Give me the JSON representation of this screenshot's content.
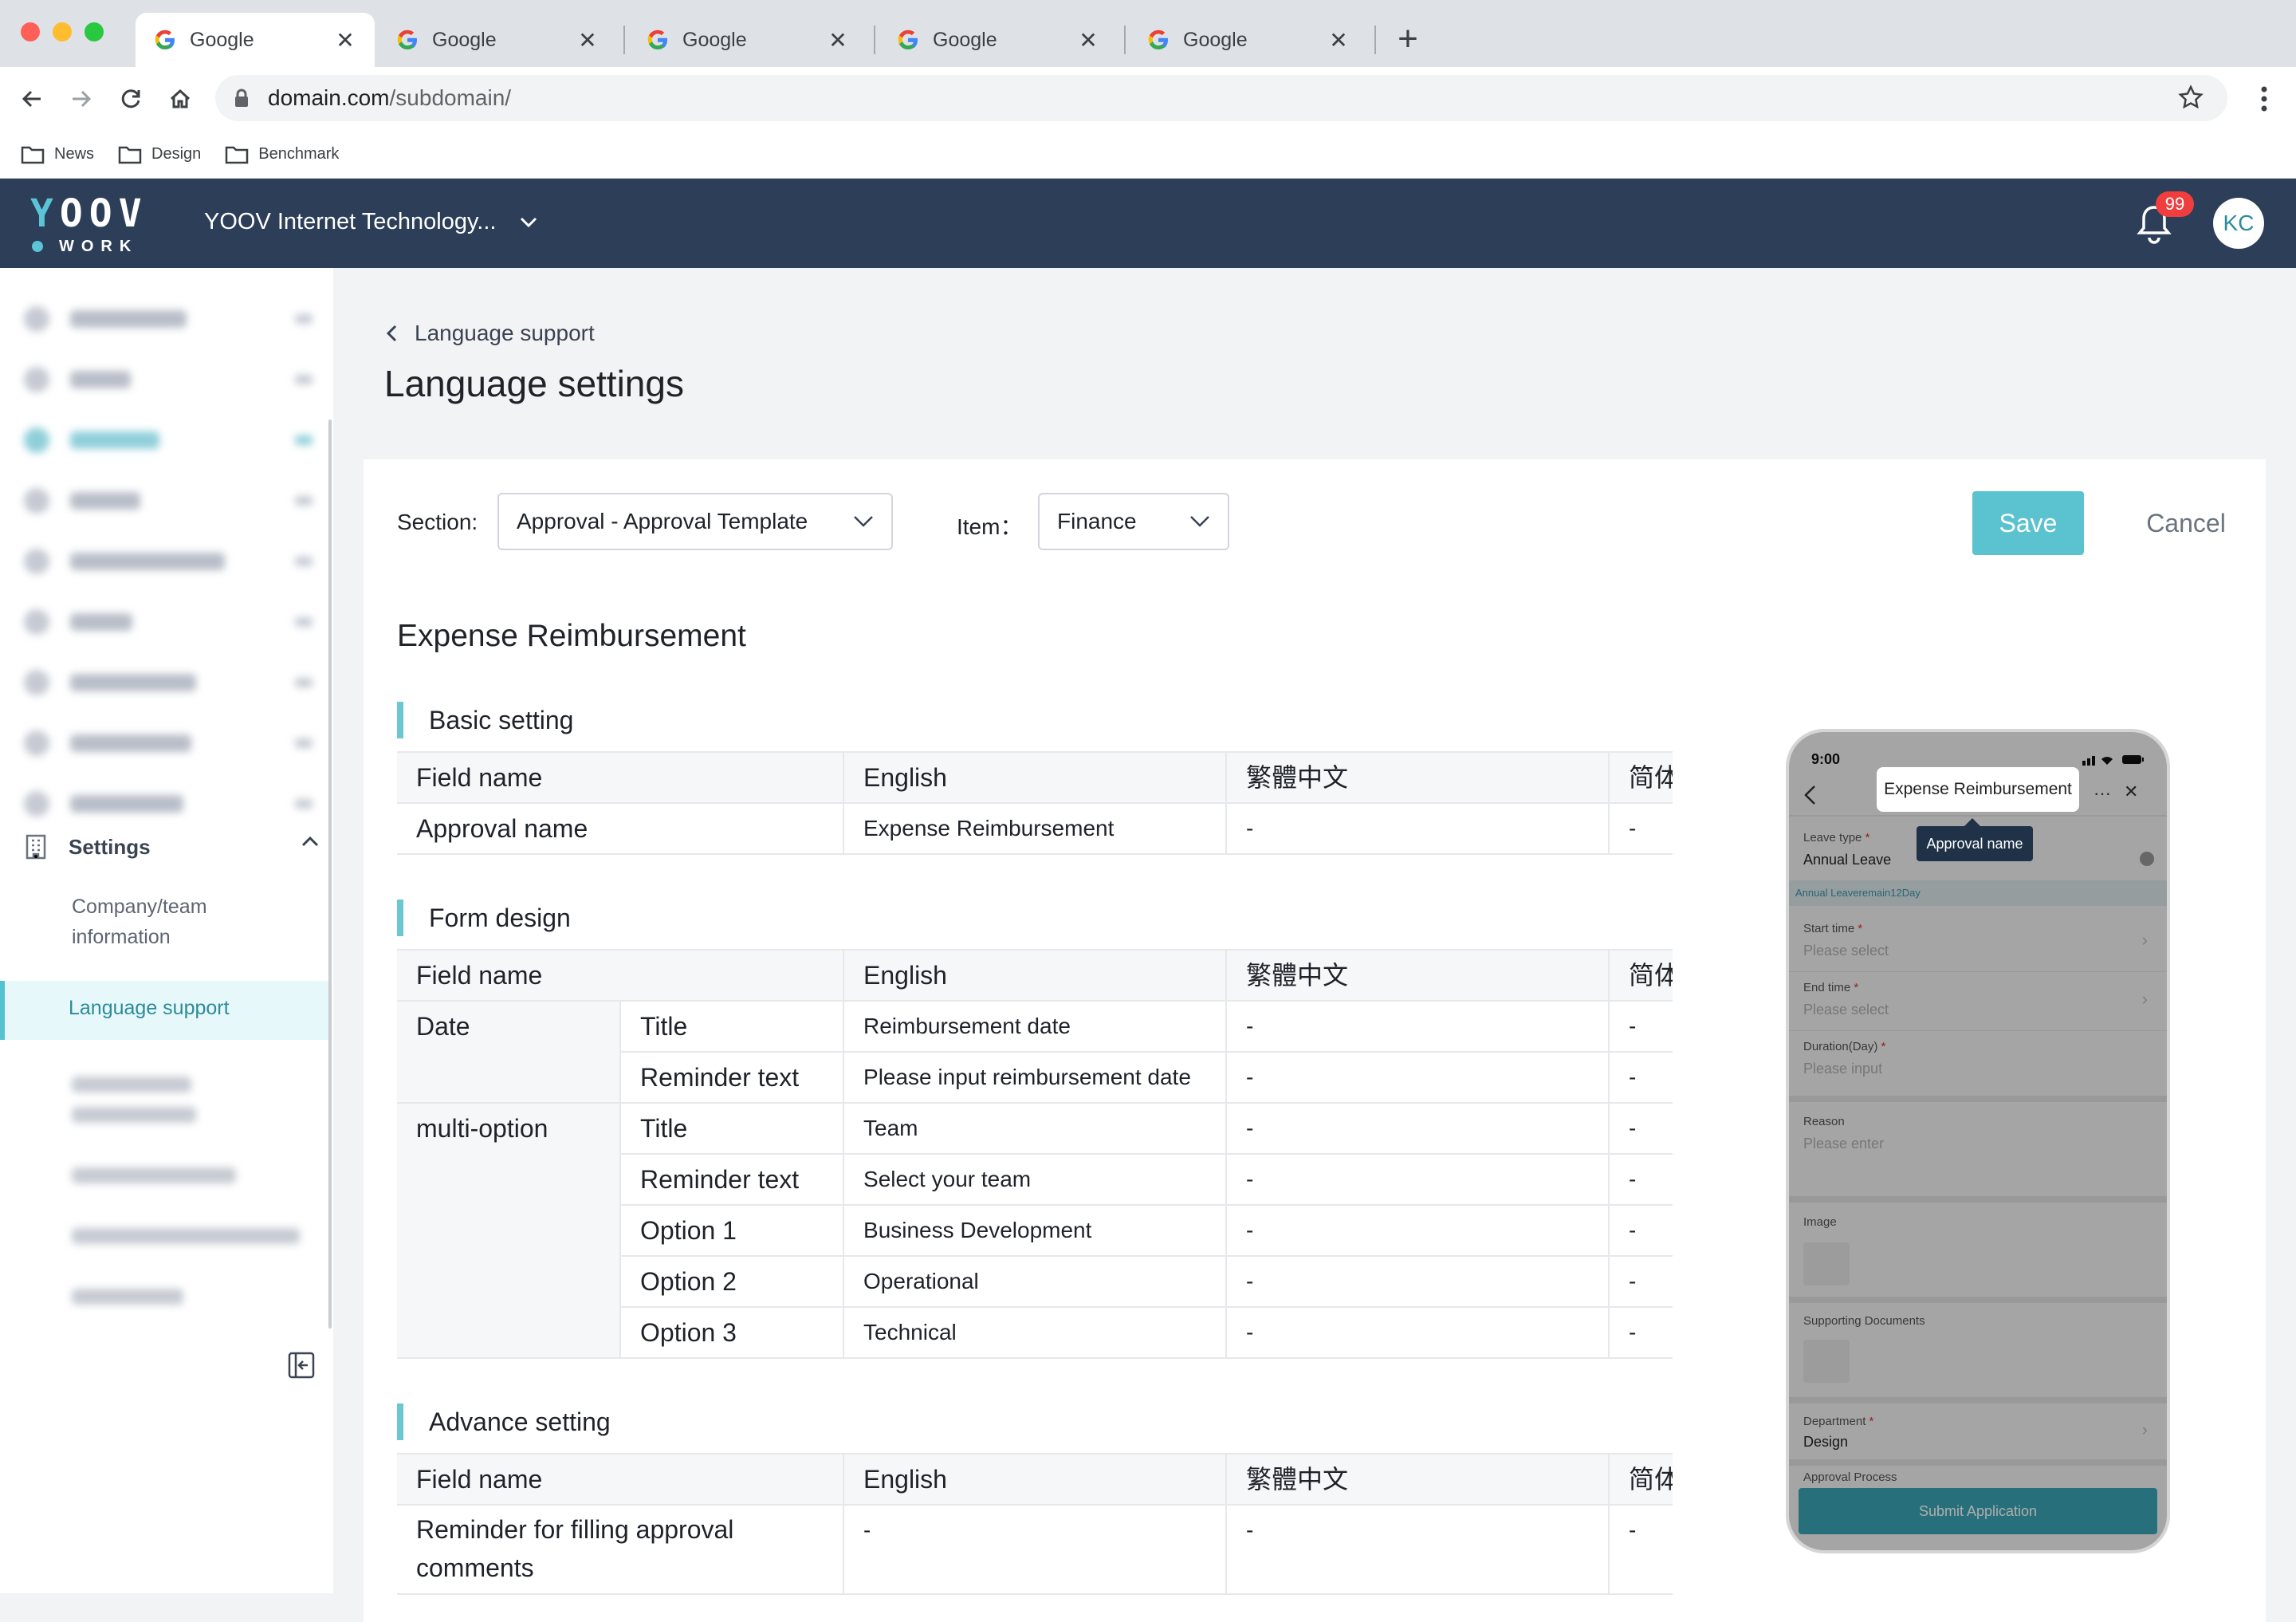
{
  "browser": {
    "tabs": [
      {
        "title": "Google",
        "active": true
      },
      {
        "title": "Google",
        "active": false
      },
      {
        "title": "Google",
        "active": false
      },
      {
        "title": "Google",
        "active": false
      },
      {
        "title": "Google",
        "active": false
      }
    ],
    "tab_close": "✕",
    "new_tab": "+",
    "url_domain": "domain.com",
    "url_path": "/subdomain/",
    "bookmarks": [
      "News",
      "Design",
      "Benchmark"
    ]
  },
  "header": {
    "logo_main": "YOOV",
    "logo_y": "Y",
    "logo_rest": "OOV",
    "logo_sub": "WORK",
    "company": "YOOV Internet Technology...",
    "notification_count": "99",
    "avatar_initials": "KC",
    "accent_color": "#2c3e58",
    "badge_color": "#f03e3e"
  },
  "sidebar": {
    "settings_label": "Settings",
    "company_info": "Company/team information",
    "company_info_line1": "Company/team",
    "company_info_line2": "information",
    "language_support": "Language support"
  },
  "main": {
    "breadcrumb": "Language support",
    "title": "Language settings",
    "section_label": "Section:",
    "section_value": "Approval - Approval Template",
    "item_label": "Item：",
    "item_value": "Finance",
    "save_label": "Save",
    "cancel_label": "Cancel",
    "heading": "Expense Reimbursement",
    "basic": {
      "title": "Basic setting",
      "headers": [
        "Field name",
        "English",
        "繁體中文",
        "简体"
      ],
      "row": {
        "field": "Approval name",
        "english": "Expense Reimbursement",
        "trad": "-",
        "simp": "-"
      }
    },
    "form": {
      "title": "Form design",
      "headers": [
        "Field name",
        "English",
        "繁體中文",
        "简体"
      ],
      "groups": [
        {
          "name": "Date",
          "rows": [
            {
              "field": "Title",
              "english": "Reimbursement date",
              "trad": "-",
              "simp": "-"
            },
            {
              "field": "Reminder text",
              "english": "Please input reimbursement date",
              "trad": "-",
              "simp": "-"
            }
          ]
        },
        {
          "name": "multi-option",
          "rows": [
            {
              "field": "Title",
              "english": "Team",
              "trad": "-",
              "simp": "-"
            },
            {
              "field": "Reminder text",
              "english": "Select your team",
              "trad": "-",
              "simp": "-"
            },
            {
              "field": "Option 1",
              "english": "Business Development",
              "trad": "-",
              "simp": "-"
            },
            {
              "field": "Option 2",
              "english": "Operational",
              "trad": "-",
              "simp": "-"
            },
            {
              "field": "Option 3",
              "english": "Technical",
              "trad": "-",
              "simp": "-"
            }
          ]
        }
      ]
    },
    "advance": {
      "title": "Advance setting",
      "headers": [
        "Field name",
        "English",
        "繁體中文",
        "简体"
      ],
      "row": {
        "field_line1": "Reminder for filling approval",
        "field_line2": "comments",
        "english": "-",
        "trad": "-",
        "simp": "-"
      }
    }
  },
  "phone": {
    "time": "9:00",
    "title": "Expense Reimbursement",
    "more": "···",
    "close": "✕",
    "tooltip": "Approval name",
    "leave_type_label": "Leave type",
    "leave_type_value": "Annual Leave",
    "hint": "Annual Leaveremain12Day",
    "start_time_label": "Start time",
    "end_time_label": "End time",
    "duration_label": "Duration(Day)",
    "reason_label": "Reason",
    "image_label": "Image",
    "supporting_label": "Supporting Documents",
    "department_label": "Department",
    "department_value": "Design",
    "approval_process_label": "Approval Process",
    "please_select": "Please select",
    "please_input": "Please input",
    "please_enter": "Please enter",
    "required_mark": "*",
    "chevron": "›",
    "submit": "Submit Application"
  }
}
